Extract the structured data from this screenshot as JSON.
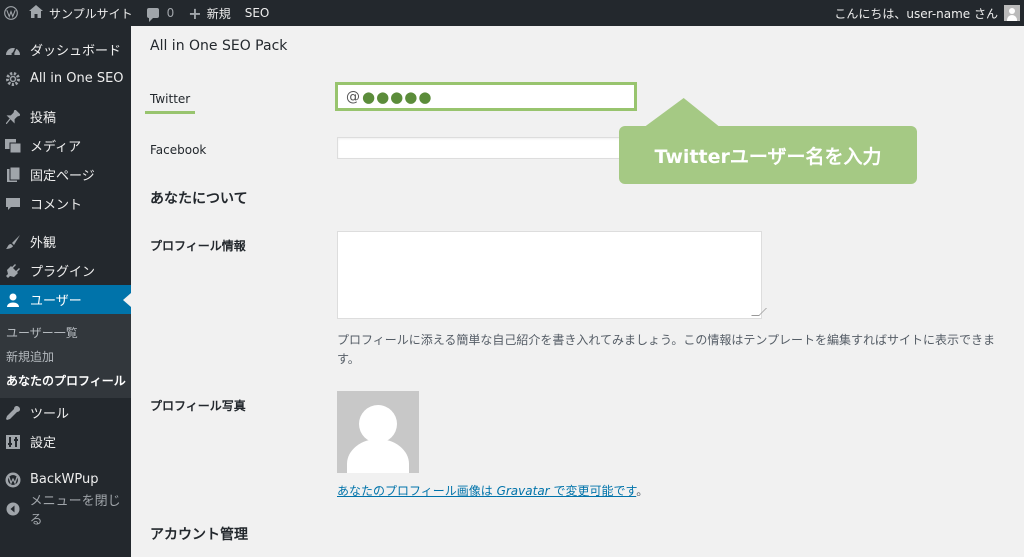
{
  "admin_bar": {
    "site_name": "サンプルサイト",
    "comments_count": "0",
    "new_label": "新規",
    "seo_label": "SEO",
    "greeting": "こんにちは、user-name さん"
  },
  "sidebar": {
    "items": [
      {
        "label": "ダッシュボード",
        "icon": "dashboard-icon"
      },
      {
        "label": "All in One SEO",
        "icon": "gear-icon"
      },
      {
        "label": "投稿",
        "icon": "pin-icon"
      },
      {
        "label": "メディア",
        "icon": "media-icon"
      },
      {
        "label": "固定ページ",
        "icon": "page-icon"
      },
      {
        "label": "コメント",
        "icon": "comment-icon"
      },
      {
        "label": "外観",
        "icon": "brush-icon"
      },
      {
        "label": "プラグイン",
        "icon": "plugin-icon"
      },
      {
        "label": "ユーザー",
        "icon": "user-icon"
      },
      {
        "label": "ツール",
        "icon": "wrench-icon"
      },
      {
        "label": "設定",
        "icon": "settings-icon"
      },
      {
        "label": "BackWPup",
        "icon": "backwpup-icon"
      },
      {
        "label": "メニューを閉じる",
        "icon": "collapse-icon"
      }
    ],
    "submenu": [
      {
        "label": "ユーザー一覧"
      },
      {
        "label": "新規追加"
      },
      {
        "label": "あなたのプロフィール"
      }
    ]
  },
  "content": {
    "aioseo_title": "All in One SEO Pack",
    "twitter_label": "Twitter",
    "twitter_value": "@",
    "twitter_mask": "●●●●●",
    "facebook_label": "Facebook",
    "callout": "Twitterユーザー名を入力",
    "about_title": "あなたについて",
    "bio_label": "プロフィール情報",
    "bio_desc": "プロフィールに添える簡単な自己紹介を書き入れてみましょう。この情報はテンプレートを編集すればサイトに表示できます。",
    "photo_label": "プロフィール写真",
    "gravatar_pre": "あなたのプロフィール画像は ",
    "gravatar_name": "Gravatar",
    "gravatar_post": " で変更可能です",
    "gravatar_period": "。",
    "account_title": "アカウント管理"
  },
  "colors": {
    "admin_dark": "#23282d",
    "accent_blue": "#0073aa",
    "highlight_green": "#98c46e",
    "callout_green": "#a5c984"
  }
}
